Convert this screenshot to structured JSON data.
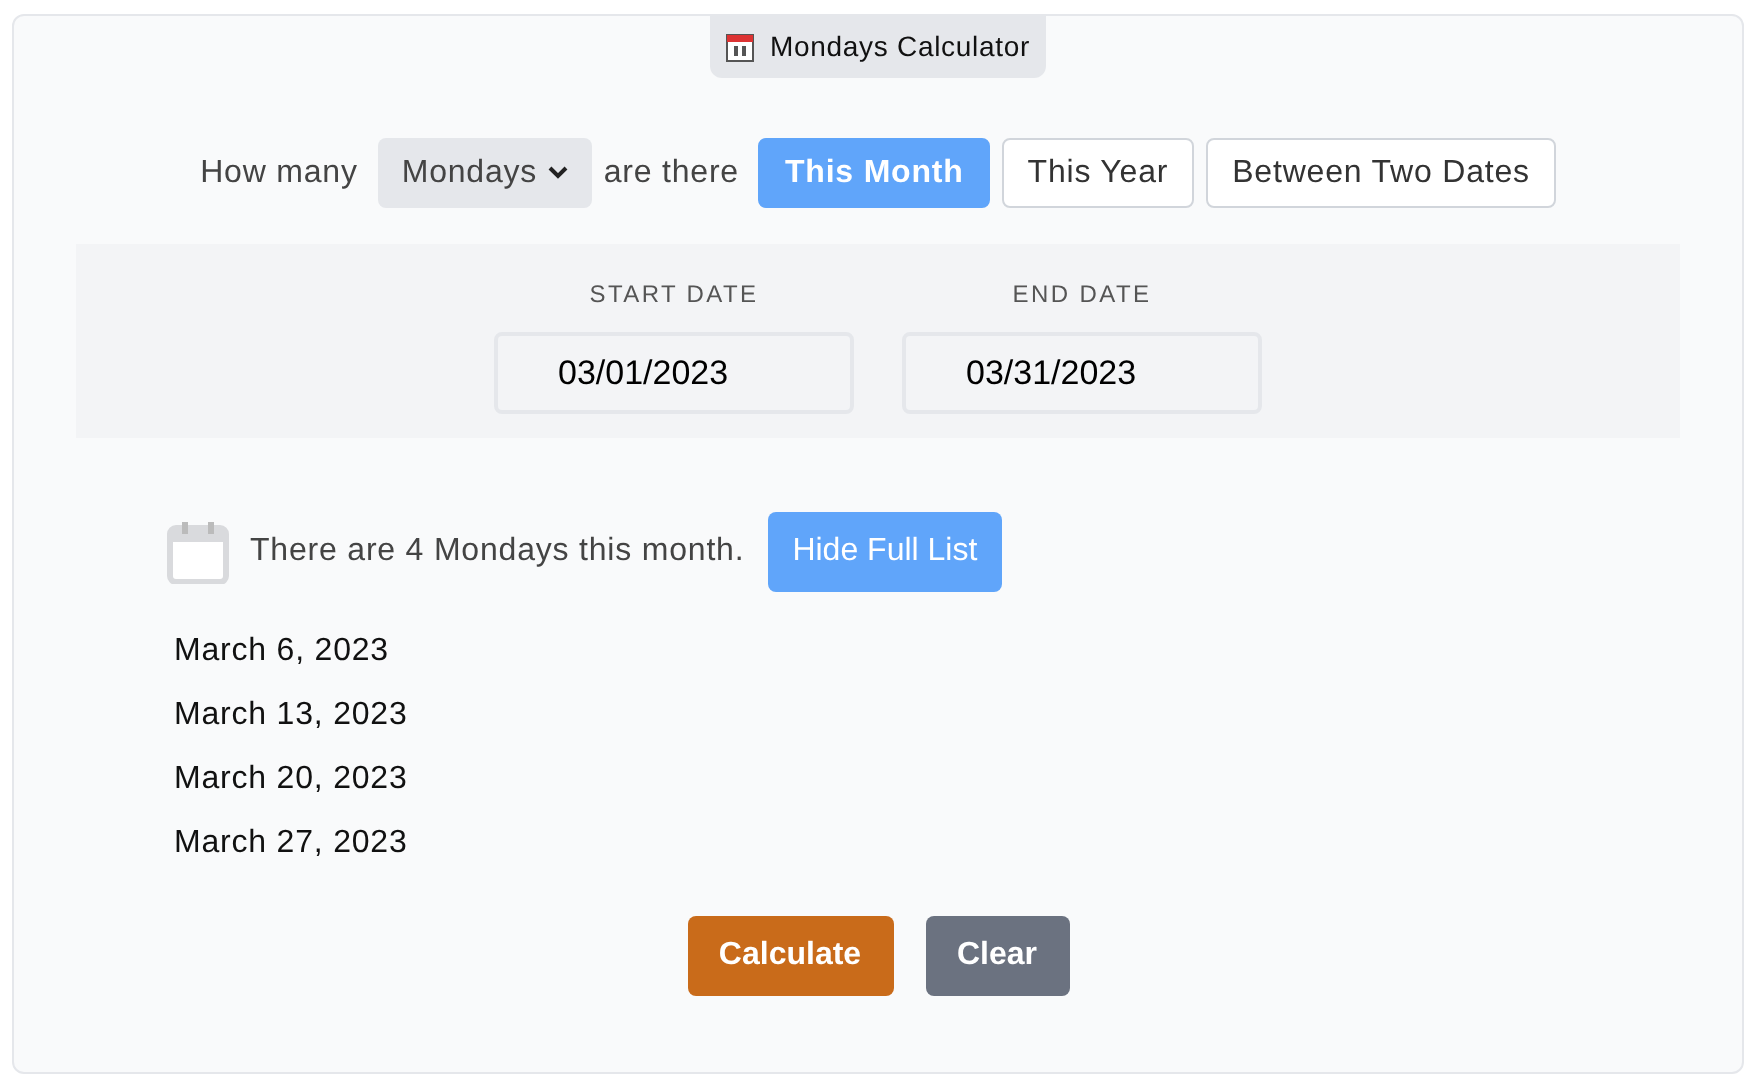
{
  "title": "Mondays Calculator",
  "prompt": {
    "before": "How many",
    "day": "Mondays",
    "after": "are there"
  },
  "modes": [
    {
      "label": "This Month",
      "selected": true
    },
    {
      "label": "This Year",
      "selected": false
    },
    {
      "label": "Between Two Dates",
      "selected": false
    }
  ],
  "dates": [
    {
      "label": "START DATE",
      "value": "03/01/2023"
    },
    {
      "label": "END DATE",
      "value": "03/31/2023"
    }
  ],
  "result": {
    "text": "There are 4 Mondays this month.",
    "toggle": "Hide Full List"
  },
  "list": [
    "March 6, 2023",
    "March 13, 2023",
    "March 20, 2023",
    "March 27, 2023"
  ],
  "buttons": [
    {
      "label": "Calculate",
      "kind": "primary"
    },
    {
      "label": "Clear",
      "kind": "secondary"
    }
  ]
}
